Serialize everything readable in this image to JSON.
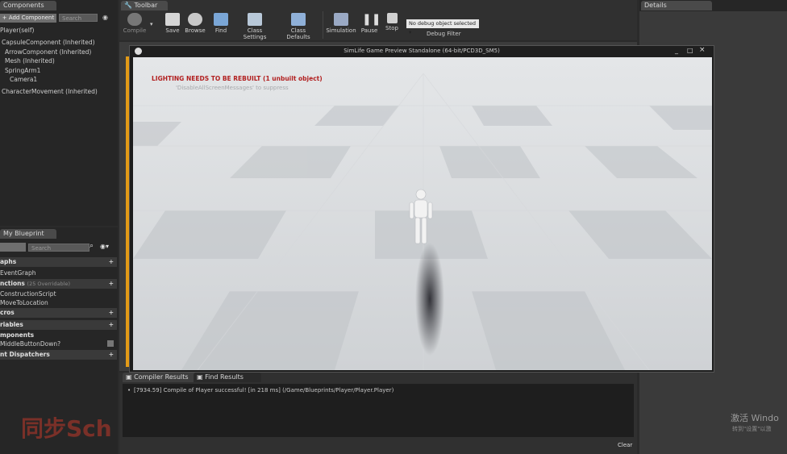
{
  "components_panel": {
    "tab": "Components",
    "add_button": "+ Add Component",
    "search_placeholder": "Search",
    "items": [
      "Player(self)",
      "CapsuleComponent (Inherited)",
      "ArrowComponent (Inherited)",
      "Mesh (Inherited)",
      "SpringArm1",
      "Camera1",
      "CharacterMovement (Inherited)"
    ]
  },
  "toolbar": {
    "tab": "Toolbar",
    "buttons": [
      "Compile",
      "Save",
      "Browse",
      "Find",
      "Class Settings",
      "Class Defaults",
      "Simulation",
      "Pause",
      "Stop"
    ],
    "debug_select": "No debug object selected",
    "debug_label": "Debug Filter"
  },
  "details_panel": {
    "tab": "Details"
  },
  "preview_window": {
    "title": "SimLife Game Preview Standalone (64-bit/PCD3D_SM5)",
    "warning": "LIGHTING NEEDS TO BE REBUILT (1 unbuilt object)",
    "hint": "'DisableAllScreenMessages' to suppress",
    "controls": [
      "_",
      "□",
      "×"
    ]
  },
  "my_blueprint": {
    "tab": "My Blueprint",
    "search_placeholder": "Search",
    "categories": {
      "graphs": "aphs",
      "event_graph": "EventGraph",
      "functions": "nctions",
      "functions_count": "(25 Overridable)",
      "construction_script": "ConstructionScript",
      "move_to_location": "MoveToLocation",
      "macros": "cros",
      "variables": "riables",
      "components": "mponents",
      "middle_button": "MiddleButtonDown?",
      "dispatchers": "nt Dispatchers"
    }
  },
  "bottom": {
    "tab_compiler": "Compiler Results",
    "tab_find": "Find Results",
    "log": "[7934.59] Compile of Player successful! [in 218 ms] (/Game/Blueprints/Player/Player.Player)",
    "clear": "Clear"
  },
  "overlay": {
    "activate": "激活 Windo",
    "activate_sub": "转到\"设置\"以激",
    "watermark": "同步Sch"
  }
}
